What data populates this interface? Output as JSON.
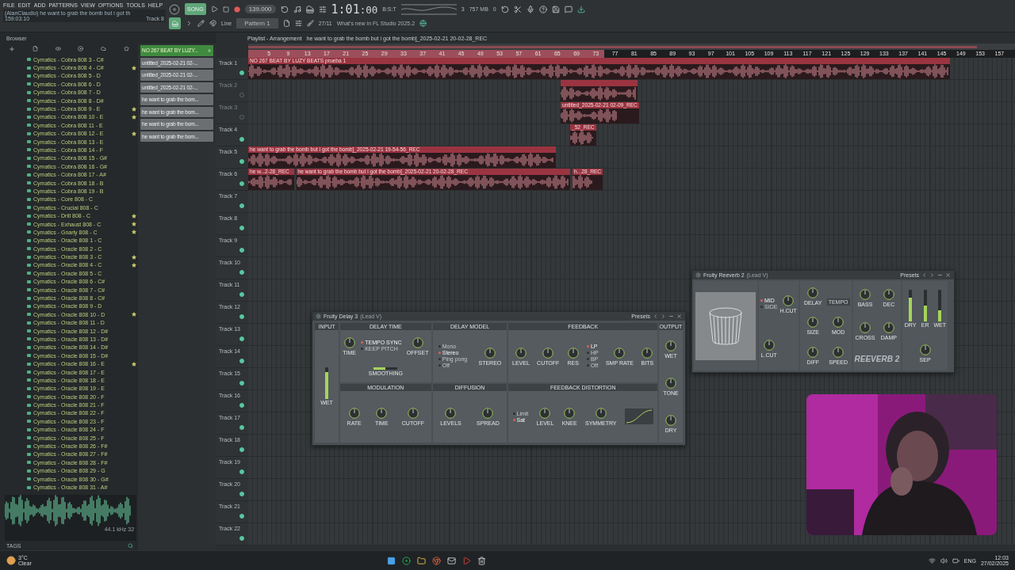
{
  "menu": [
    "FILE",
    "EDIT",
    "ADD",
    "PATTERNS",
    "VIEW",
    "OPTIONS",
    "TOOLS",
    "HELP"
  ],
  "hint": {
    "title": "(AlanClaudio) he want to grab the bomb but i got th",
    "time": "159:03:10",
    "track": "Track 8"
  },
  "transport": {
    "mode": "SONG",
    "recording": true,
    "tempo": "139.000",
    "time": "1:01",
    "time_sub": ":00",
    "time_unit": "B:S:T",
    "voices": "3",
    "memory": "757 MB",
    "cpu": "0"
  },
  "toolbar": {
    "snap": "Line",
    "pattern": "Pattern 1",
    "news_date": "27/11",
    "news": "What's new in FL Studio 2025.2"
  },
  "browser": {
    "title": "Browser",
    "items": [
      {
        "name": "Cymatics - Cobra 808 3 - C#",
        "starred": false
      },
      {
        "name": "Cymatics - Cobra 808 4 - C#",
        "starred": true
      },
      {
        "name": "Cymatics - Cobra 808 5 - D",
        "starred": false
      },
      {
        "name": "Cymatics - Cobra 808 6 - D",
        "starred": false
      },
      {
        "name": "Cymatics - Cobra 808 7 - D",
        "starred": false
      },
      {
        "name": "Cymatics - Cobra 808 8 - D#",
        "starred": false
      },
      {
        "name": "Cymatics - Cobra 808 9 - E",
        "starred": true
      },
      {
        "name": "Cymatics - Cobra 808 10 - E",
        "starred": true
      },
      {
        "name": "Cymatics - Cobra 808 11 - E",
        "starred": false
      },
      {
        "name": "Cymatics - Cobra 808 12 - E",
        "starred": true
      },
      {
        "name": "Cymatics - Cobra 808 13 - E",
        "starred": false
      },
      {
        "name": "Cymatics - Cobra 808 14 - F",
        "starred": false
      },
      {
        "name": "Cymatics - Cobra 808 15 - G#",
        "starred": false
      },
      {
        "name": "Cymatics - Cobra 808 16 - G#",
        "starred": false
      },
      {
        "name": "Cymatics - Cobra 808 17 - A#",
        "starred": false
      },
      {
        "name": "Cymatics - Cobra 808 18 - B",
        "starred": false
      },
      {
        "name": "Cymatics - Cobra 808 19 - B",
        "starred": false
      },
      {
        "name": "Cymatics - Core 808 - C",
        "starred": false
      },
      {
        "name": "Cymatics - Crucial 808 - C",
        "starred": false
      },
      {
        "name": "Cymatics - Drill 808 - C",
        "starred": true
      },
      {
        "name": "Cymatics - Exhaust 808 - C",
        "starred": true
      },
      {
        "name": "Cymatics - Gnarly 808 - C",
        "starred": true
      },
      {
        "name": "Cymatics - Oracle 808 1 - C",
        "starred": false
      },
      {
        "name": "Cymatics - Oracle 808 2 - C",
        "starred": false
      },
      {
        "name": "Cymatics - Oracle 808 3 - C",
        "starred": true
      },
      {
        "name": "Cymatics - Oracle 808 4 - C",
        "starred": true
      },
      {
        "name": "Cymatics - Oracle 808 5 - C",
        "starred": false
      },
      {
        "name": "Cymatics - Oracle 808 6 - C#",
        "starred": false
      },
      {
        "name": "Cymatics - Oracle 808 7 - C#",
        "starred": false
      },
      {
        "name": "Cymatics - Oracle 808 8 - C#",
        "starred": false
      },
      {
        "name": "Cymatics - Oracle 808 9 - D",
        "starred": false
      },
      {
        "name": "Cymatics - Oracle 808 10 - D",
        "starred": true
      },
      {
        "name": "Cymatics - Oracle 808 11 - D",
        "starred": false
      },
      {
        "name": "Cymatics - Oracle 808 12 - D#",
        "starred": false
      },
      {
        "name": "Cymatics - Oracle 808 13 - D#",
        "starred": false
      },
      {
        "name": "Cymatics - Oracle 808 14 - D#",
        "starred": false
      },
      {
        "name": "Cymatics - Oracle 808 15 - D#",
        "starred": false
      },
      {
        "name": "Cymatics - Oracle 808 16 - E",
        "starred": true
      },
      {
        "name": "Cymatics - Oracle 808 17 - E",
        "starred": false
      },
      {
        "name": "Cymatics - Oracle 808 18 - E",
        "starred": false
      },
      {
        "name": "Cymatics - Oracle 808 19 - E",
        "starred": false
      },
      {
        "name": "Cymatics - Oracle 808 20 - F",
        "starred": false
      },
      {
        "name": "Cymatics - Oracle 808 21 - F",
        "starred": false
      },
      {
        "name": "Cymatics - Oracle 808 22 - F",
        "starred": false
      },
      {
        "name": "Cymatics - Oracle 808 23 - F",
        "starred": false
      },
      {
        "name": "Cymatics - Oracle 808 24 - F",
        "starred": false
      },
      {
        "name": "Cymatics - Oracle 808 25 - F",
        "starred": false
      },
      {
        "name": "Cymatics - Oracle 808 26 - F#",
        "starred": false
      },
      {
        "name": "Cymatics - Oracle 808 27 - F#",
        "starred": false
      },
      {
        "name": "Cymatics - Oracle 808 28 - F#",
        "starred": false
      },
      {
        "name": "Cymatics - Oracle 808 29 - G",
        "starred": false
      },
      {
        "name": "Cymatics - Oracle 808 30 - G#",
        "starred": false
      },
      {
        "name": "Cymatics - Oracle 808 31 - A#",
        "starred": false
      }
    ],
    "preview": {
      "info": "44.1 kHz 32",
      "tags": "TAGS"
    }
  },
  "clips_panel": [
    {
      "label": "NO 267 BEAT BY LUZY...",
      "kind": "pattern"
    },
    {
      "label": "untitled_2025-02-21 02-...",
      "kind": "audio"
    },
    {
      "label": "untitled_2025-02-21 02-...",
      "kind": "audio"
    },
    {
      "label": "untitled_2025-02-21 02-...",
      "kind": "audio"
    },
    {
      "label": "he want to grab the bom...",
      "kind": "audio"
    },
    {
      "label": "he want to grab the bom...",
      "kind": "audio"
    },
    {
      "label": "he want to grab the bom...",
      "kind": "audio"
    },
    {
      "label": "he want to grab the bom...",
      "kind": "audio"
    }
  ],
  "playlist": {
    "title": "Playlist - Arrangement",
    "song": "he want to grab the bomb but i got the bomb]_2025-02-21 20-02-28_REC",
    "ruler": [
      "5",
      "9",
      "13",
      "17",
      "21",
      "25",
      "29",
      "33",
      "37",
      "41",
      "45",
      "49",
      "53",
      "57",
      "61",
      "65",
      "69",
      "73",
      "77",
      "81",
      "85",
      "89",
      "93",
      "97",
      "101",
      "105",
      "109",
      "113",
      "117",
      "121",
      "125",
      "129",
      "133",
      "137",
      "141",
      "145",
      "149",
      "153",
      "157"
    ],
    "tracks": [
      {
        "name": "Track 1",
        "muted": false,
        "clips": [
          {
            "kind": "audio",
            "label": "NO 267 BEAT BY LUZY BEATS prueba 1"
          }
        ]
      },
      {
        "name": "Track 2",
        "muted": true,
        "clips": [
          {
            "kind": "audio"
          }
        ]
      },
      {
        "name": "Track 3",
        "muted": true,
        "clips": [
          {
            "kind": "audio",
            "label": "untitled_2025-02-21 02-09_REC"
          }
        ]
      },
      {
        "name": "Track 4",
        "muted": false,
        "clips": [
          {
            "kind": "audio",
            "label": "_52_REC"
          }
        ]
      },
      {
        "name": "Track 5",
        "muted": false,
        "clips": [
          {
            "kind": "audio",
            "label": "he want to grab the bomb but i got the bomb]_2025-02-21 19-54-56_REC"
          }
        ]
      },
      {
        "name": "Track 6",
        "muted": false,
        "clips": [
          {
            "kind": "audio",
            "label": "he w...2-28_REC"
          },
          {
            "kind": "audio",
            "label": "he want to grab the bomb but i got the bomb]_2025-02-21 20-02-28_REC"
          },
          {
            "kind": "audio",
            "label": "h...28_REC"
          }
        ]
      },
      {
        "name": "Track 7",
        "muted": false
      },
      {
        "name": "Track 8",
        "muted": false
      },
      {
        "name": "Track 9",
        "muted": false
      },
      {
        "name": "Track 10",
        "muted": false
      },
      {
        "name": "Track 11",
        "muted": false
      },
      {
        "name": "Track 12",
        "muted": false
      },
      {
        "name": "Track 13",
        "muted": false
      },
      {
        "name": "Track 14",
        "muted": false
      },
      {
        "name": "Track 15",
        "muted": false
      },
      {
        "name": "Track 16",
        "muted": false
      },
      {
        "name": "Track 17",
        "muted": false
      },
      {
        "name": "Track 18",
        "muted": false
      },
      {
        "name": "Track 19",
        "muted": false
      },
      {
        "name": "Track 20",
        "muted": false
      },
      {
        "name": "Track 21",
        "muted": false
      },
      {
        "name": "Track 22",
        "muted": false
      }
    ]
  },
  "delay": {
    "title": "Fruity Delay 3",
    "target": "(Lead V)",
    "presets": "Presets",
    "sections": [
      {
        "title": "INPUT",
        "controls": [
          {
            "kind": "fader",
            "label": "WET",
            "level": 0.85
          }
        ]
      },
      {
        "title": "DELAY TIME",
        "controls": [
          {
            "kind": "knob",
            "label": "TIME"
          },
          {
            "kind": "options",
            "options": [
              {
                "label": "TEMPO SYNC",
                "selected": true
              },
              {
                "label": "KEEP PITCH",
                "selected": false
              }
            ]
          },
          {
            "kind": "knob",
            "label": "OFFSET"
          },
          {
            "kind": "slider",
            "label": "SMOOTHING",
            "level": 0.5
          }
        ]
      },
      {
        "title": "DELAY MODEL",
        "controls": [
          {
            "kind": "options",
            "options": [
              {
                "label": "Mono",
                "selected": false
              },
              {
                "label": "Stereo",
                "selected": true
              },
              {
                "label": "Ping pong",
                "selected": false
              },
              {
                "label": "Off",
                "selected": false
              }
            ]
          },
          {
            "kind": "knob",
            "label": "STEREO"
          }
        ]
      },
      {
        "title": "FEEDBACK",
        "controls": [
          {
            "kind": "knob",
            "label": "LEVEL"
          },
          {
            "kind": "knob",
            "label": "CUTOFF"
          },
          {
            "kind": "knob",
            "label": "RES"
          },
          {
            "kind": "options",
            "options": [
              {
                "label": "LP",
                "selected": true
              },
              {
                "label": "HP",
                "selected": false
              },
              {
                "label": "BP",
                "selected": false
              },
              {
                "label": "Off",
                "selected": false
              }
            ]
          },
          {
            "kind": "knob",
            "label": "SMP RATE"
          },
          {
            "kind": "knob",
            "label": "BITS"
          }
        ]
      },
      {
        "title": "OUTPUT",
        "controls": [
          {
            "kind": "knob",
            "label": "WET"
          },
          {
            "kind": "knob",
            "label": "TONE"
          },
          {
            "kind": "knob",
            "label": "DRY"
          }
        ]
      },
      {
        "title": "MODULATION",
        "controls": [
          {
            "kind": "knob",
            "label": "RATE"
          },
          {
            "kind": "knob",
            "label": "TIME"
          },
          {
            "kind": "knob",
            "label": "CUTOFF"
          }
        ]
      },
      {
        "title": "DIFFUSION",
        "controls": [
          {
            "kind": "knob",
            "label": "LEVELS"
          },
          {
            "kind": "knob",
            "label": "SPREAD"
          }
        ]
      },
      {
        "title": "FEEDBACK DISTORTION",
        "controls": [
          {
            "kind": "options",
            "options": [
              {
                "label": "Limit",
                "selected": false
              },
              {
                "label": "Sat",
                "selected": true
              }
            ]
          },
          {
            "kind": "knob",
            "label": "LEVEL"
          },
          {
            "kind": "knob",
            "label": "KNEE"
          },
          {
            "kind": "knob",
            "label": "SYMMETRY"
          },
          {
            "kind": "curve"
          }
        ]
      }
    ]
  },
  "reverb": {
    "title": "Fruity Reeverb 2",
    "target": "(Lead V)",
    "presets": "Presets",
    "groups": [
      [
        {
          "kind": "display"
        }
      ],
      [
        {
          "kind": "options",
          "options": [
            {
              "label": "MID",
              "selected": true
            },
            {
              "label": "SIDE",
              "selected": false
            }
          ]
        },
        {
          "kind": "knob",
          "label": "H.CUT"
        },
        {
          "kind": "knob",
          "label": "L.CUT"
        }
      ],
      [
        {
          "kind": "knob",
          "label": "DELAY"
        },
        {
          "kind": "button",
          "label": "TEMPO"
        },
        {
          "kind": "knob",
          "label": "SIZE"
        },
        {
          "kind": "knob",
          "label": "MOD"
        },
        {
          "kind": "knob",
          "label": "DIFF"
        },
        {
          "kind": "knob",
          "label": "SPEED"
        }
      ],
      [
        {
          "kind": "knob",
          "label": "BASS"
        },
        {
          "kind": "knob",
          "label": "DEC"
        },
        {
          "kind": "knob",
          "label": "CROSS"
        },
        {
          "kind": "knob",
          "label": "DAMP"
        },
        {
          "kind": "logo",
          "label": "REEVERB 2"
        }
      ],
      [
        {
          "kind": "fader",
          "label": "DRY",
          "level": 0.75
        },
        {
          "kind": "fader",
          "label": "ER",
          "level": 0.5
        },
        {
          "kind": "fader",
          "label": "WET",
          "level": 0.35
        },
        {
          "kind": "knob",
          "label": "SEP"
        }
      ]
    ]
  },
  "taskbar": {
    "temp": "3°C",
    "condition": "Clear",
    "language": "ENG",
    "time": "12:03",
    "date": "27/02/2025"
  }
}
